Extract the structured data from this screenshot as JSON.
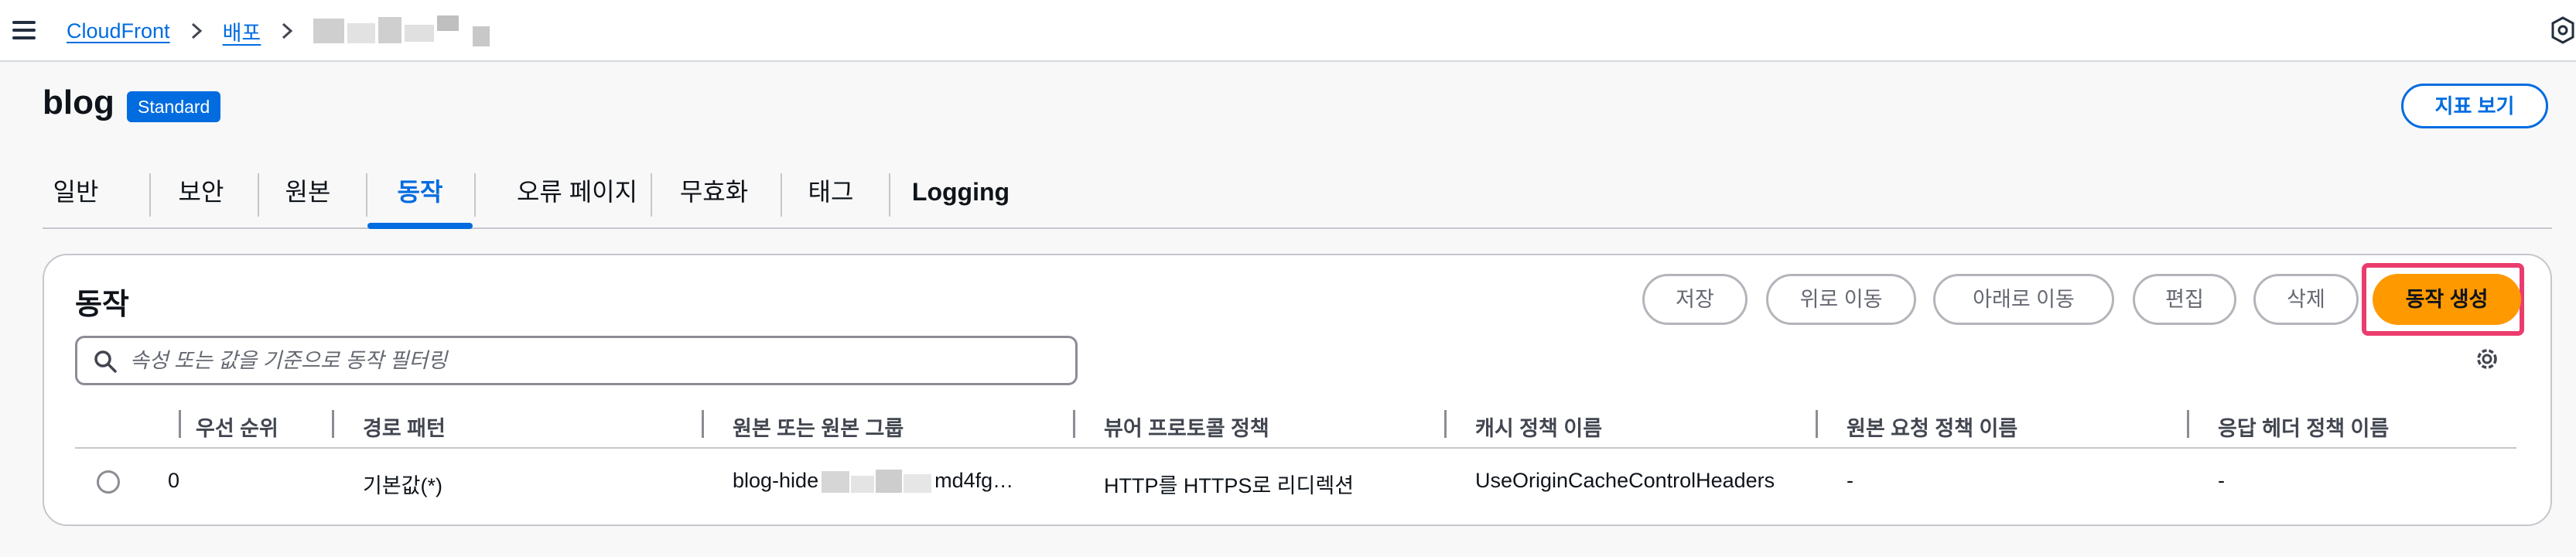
{
  "breadcrumb": {
    "root": "CloudFront",
    "section": "배포"
  },
  "header": {
    "title": "blog",
    "badge": "Standard",
    "metrics_button": "지표 보기"
  },
  "tabs": [
    {
      "label": "일반"
    },
    {
      "label": "보안"
    },
    {
      "label": "원본"
    },
    {
      "label": "동작",
      "active": true
    },
    {
      "label": "오류 페이지"
    },
    {
      "label": "무효화"
    },
    {
      "label": "태그"
    },
    {
      "label": "Logging"
    }
  ],
  "behaviors": {
    "title": "동작",
    "buttons": {
      "save": "저장",
      "move_up": "위로 이동",
      "move_down": "아래로 이동",
      "edit": "편집",
      "delete": "삭제",
      "create": "동작 생성"
    },
    "search_placeholder": "속성 또는 값을 기준으로 동작 필터링",
    "columns": [
      "우선 순위",
      "경로 패턴",
      "원본 또는 원본 그룹",
      "뷰어 프로토콜 정책",
      "캐시 정책 이름",
      "원본 요청 정책 이름",
      "응답 헤더 정책 이름"
    ],
    "rows": [
      {
        "priority": "0",
        "path_pattern": "기본값(*)",
        "origin_prefix": "blog-hide",
        "origin_suffix": "md4fg…",
        "viewer_protocol": "HTTP를 HTTPS로 리디렉션",
        "cache_policy": "UseOriginCacheControlHeaders",
        "origin_request_policy": "-",
        "response_headers_policy": "-"
      }
    ]
  },
  "colors": {
    "link": "#006ce0",
    "primary": "#ff9900",
    "highlight": "#eb3c6e"
  }
}
